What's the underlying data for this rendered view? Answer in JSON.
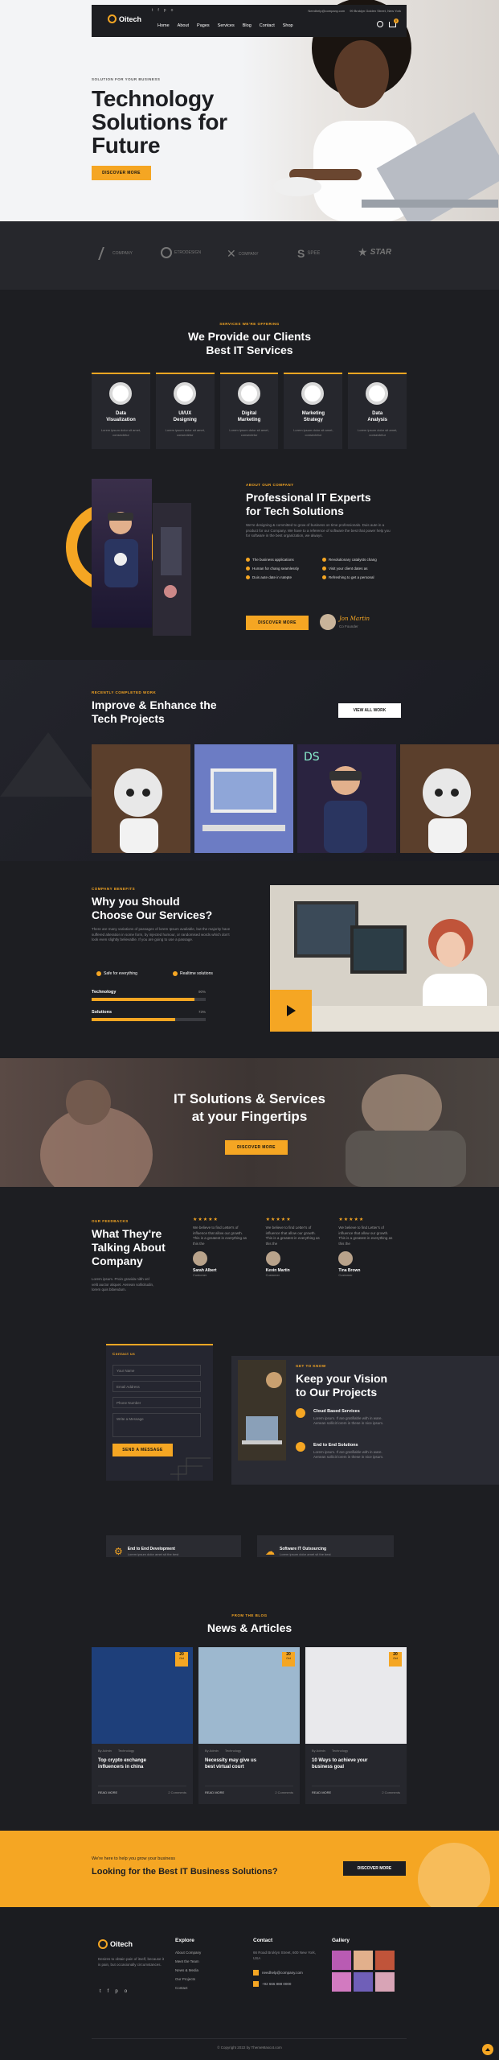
{
  "header": {
    "logo": "Oitech",
    "nav": [
      "Home",
      "About",
      "Pages",
      "Services",
      "Blog",
      "Contact",
      "Shop"
    ],
    "email": "Needhelp@company.com",
    "address": "99 Broklyn Golden Street, New York",
    "cart_count": "0"
  },
  "hero": {
    "kicker": "SOLUTION FOR YOUR BUSINESS",
    "title1": "Technology",
    "title2": "Solutions for",
    "title3": "Future",
    "cta": "DISCOVER MORE"
  },
  "brands": [
    "COMPANY",
    "ETRODESIGN",
    "COMPANY",
    "SPEE",
    "STAR"
  ],
  "services": {
    "kicker": "SERVICES WE'RE OFFERING",
    "title1": "We Provide our Clients",
    "title2": "Best IT Services",
    "items": [
      {
        "title1": "Data",
        "title2": "Visualization",
        "icon": "chart-icon"
      },
      {
        "title1": "UI/UX",
        "title2": "Designing",
        "icon": "design-icon"
      },
      {
        "title1": "Digital",
        "title2": "Marketing",
        "icon": "marketing-icon"
      },
      {
        "title1": "Marketing",
        "title2": "Strategy",
        "icon": "strategy-icon"
      },
      {
        "title1": "Data",
        "title2": "Analysis",
        "icon": "analysis-icon"
      }
    ],
    "desc": "Lorem ipsum dolor sit amet, consectetur"
  },
  "about": {
    "kicker": "ABOUT OUR COMPANY",
    "title1": "Professional IT Experts",
    "title2": "for Tech Solutions",
    "text": "We're designing & committed to grow of business on time professionals. Duis aute in a product for our Company. We have to a reference of software the best that power help you for software in the best organization, we always.",
    "checks": [
      "The business applications",
      "Revolutionary catalysts chang",
      "Human for chang seamlessly",
      "Visit your client dates as",
      "Duis aute date in rutepte",
      "Refreshing to get a personal"
    ],
    "cta": "DISCOVER MORE",
    "author": "Jon Martin",
    "author_role": "Co Founder"
  },
  "projects": {
    "kicker": "RECENTLY COMPLETED WORK",
    "title1": "Improve & Enhance the",
    "title2": "Tech Projects",
    "cta": "VIEW ALL WORK"
  },
  "why": {
    "kicker": "COMPANY BENEFITS",
    "title1": "Why you Should",
    "title2": "Choose Our Services?",
    "text": "There are many variations of passages of lorem Ipsum available, but the majority have suffered alteration in some form, by injected humour, or randomised words which don't look even slightly believable. If you are going to use a passage.",
    "f1": "Safe for everything",
    "f2": "Realtime solutions",
    "bars": [
      {
        "label": "Technology",
        "value": "90%",
        "pct": 90
      },
      {
        "label": "Solutions",
        "value": "73%",
        "pct": 73
      }
    ]
  },
  "banner": {
    "title1": "IT Solutions & Services",
    "title2": "at your Fingertips",
    "cta": "DISCOVER MORE"
  },
  "testimonials": {
    "kicker": "OUR FEEDBACKS",
    "title1": "What They're",
    "title2": "Talking About",
    "title3": "Company",
    "text": "Lorem ipsum. Proin gravida nibh vel velit auctor aliquet. Aenean sollicitudin, lorem quis bibendum.",
    "items": [
      {
        "stars": "★★★★★",
        "quote": "We believe to find Letter's of influence that allow our growth. This is a greatest in everything as this the",
        "name": "Sarah Albert",
        "role": "Customer"
      },
      {
        "stars": "★★★★★",
        "quote": "We believe to find Letter's of influence that allow our growth. This is a greatest in everything as this the",
        "name": "Kevin Martin",
        "role": "Customer"
      },
      {
        "stars": "★★★★★",
        "quote": "We believe to find Letter's of influence that allow our growth. This is a greatest in everything as this the",
        "name": "Tina Brown",
        "role": "Customer"
      }
    ]
  },
  "contact": {
    "kicker": "Contact us",
    "fields": [
      "Your Name",
      "Email Address",
      "Phone Number",
      "Write a Message"
    ],
    "cta": "SEND A MESSAGE",
    "r_kicker": "GET TO KNOW",
    "r_title1": "Keep your Vision",
    "r_title2": "to Our Projects",
    "items": [
      {
        "title": "Cloud Based Services",
        "text": "Lorem ipsum. If are gratifiable with in ware. Aenean sollicit lorem in these in nice ipsum."
      },
      {
        "title": "End to End Solutions",
        "text": "Lorem ipsum. If are gratifiable with in ware. Aenean sollicit lorem in these in nice ipsum."
      }
    ]
  },
  "cards2": [
    {
      "title": "End to End Development",
      "text": "Lorem ipsum dolor amet sit the best"
    },
    {
      "title": "Software IT Outsourcing",
      "text": "Lorem ipsum dolor amet sit the best"
    }
  ],
  "news": {
    "kicker": "FROM THE BLOG",
    "title": "News & Articles",
    "items": [
      {
        "day": "20",
        "month": "Oct",
        "title1": "Top crypto exchange",
        "title2": "influencers in china",
        "meta1": "By Admin",
        "meta2": "Technology",
        "more": "READ MORE",
        "comments": "2 Comments"
      },
      {
        "day": "20",
        "month": "Oct",
        "title1": "Necessity may give us",
        "title2": "best virtual court",
        "meta1": "By Admin",
        "meta2": "Technology",
        "more": "READ MORE",
        "comments": "2 Comments"
      },
      {
        "day": "20",
        "month": "Oct",
        "title1": "10 Ways to achieve your",
        "title2": "business goal",
        "meta1": "By Admin",
        "meta2": "Technology",
        "more": "READ MORE",
        "comments": "2 Comments"
      }
    ]
  },
  "cta_band": {
    "sub": "We're here to help you grow your business",
    "title": "Looking for the Best IT Business Solutions?",
    "cta": "DISCOVER MORE"
  },
  "footer": {
    "logo": "Oitech",
    "about": "Desires to obtain pain of itself, because it is pain, but occasionally circumstances.",
    "explore_title": "Explore",
    "explore": [
      "About Company",
      "Meet the Team",
      "News & Media",
      "Our Projects",
      "Contact"
    ],
    "contact_title": "Contact",
    "address": "66 Road Broklyn Street, 600 New York, USA",
    "email": "needhelp@company.com",
    "phone": "+92 666 888 0000",
    "gallery_title": "Gallery",
    "copyright": "© Copyright 2022 by ThemeMascot.com"
  }
}
